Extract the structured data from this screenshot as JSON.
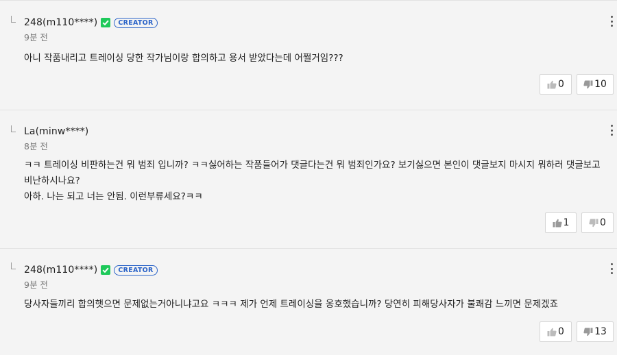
{
  "comments": [
    {
      "author": "248(m110****)",
      "verified": true,
      "badge": "CREATOR",
      "time": "9분 전",
      "text": "아니 작품내리고 트레이싱 당한 작가님이랑 합의하고 용서 받았다는데 어쩔거임???",
      "likes": "0",
      "dislikes": "10"
    },
    {
      "author": "La(minw****)",
      "verified": false,
      "badge": "",
      "time": "8분 전",
      "text": "ㅋㅋ 트레이싱 비판하는건 뭐 범죄 입니까? ㅋㅋ싫어하는 작품들어가 댓글다는건 뭐 범죄인가요? 보기싫으면 본인이 댓글보지 마시지 뭐하러 댓글보고 비난하시나요?\n아하. 나는 되고 너는 안됨. 이런부류세요?ㅋㅋ",
      "likes": "1",
      "dislikes": "0"
    },
    {
      "author": "248(m110****)",
      "verified": true,
      "badge": "CREATOR",
      "time": "9분 전",
      "text": "당사자들끼리 합의햇으면 문제없는거아니냐고요 ㅋㅋㅋ 제가 언제 트레이싱을 옹호했습니까? 당연히 피해당사자가 불쾌감 느끼면 문제겠죠",
      "likes": "0",
      "dislikes": "13"
    }
  ],
  "icons": {
    "like": "thumbs-up-icon",
    "dislike": "thumbs-down-icon",
    "more": "more-vertical-icon",
    "verified": "check-icon"
  },
  "colors": {
    "verified": "#1ec95a",
    "creator_badge": "#2a63c8",
    "background": "#f4f4f4"
  }
}
